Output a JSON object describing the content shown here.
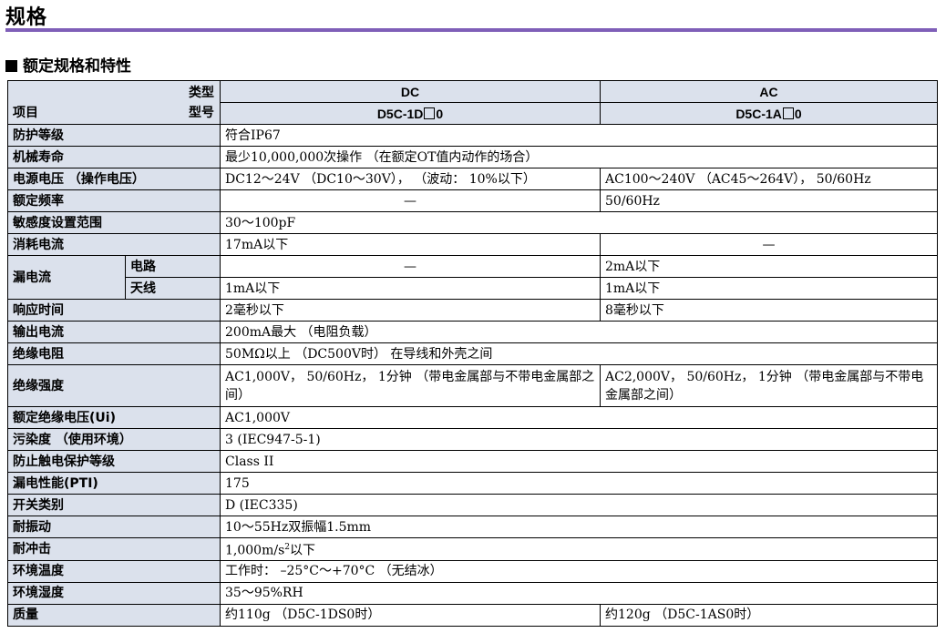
{
  "page_title": "规格",
  "section_heading": "额定规格和特性",
  "header": {
    "type_label": "类型",
    "item_label": "项目",
    "model_label": "型号",
    "dc": {
      "type": "DC",
      "model_prefix": "D5C-1D",
      "model_suffix": "0"
    },
    "ac": {
      "type": "AC",
      "model_prefix": "D5C-1A",
      "model_suffix": "0"
    }
  },
  "rows": {
    "protection": {
      "label": "防护等级",
      "value": "符合IP67"
    },
    "mech_life": {
      "label": "机械寿命",
      "value": "最少10,000,000次操作 （在额定OT值内动作的场合）"
    },
    "supply_voltage": {
      "label": "电源电压 （操作电压）",
      "dc": "DC12～24V （DC10～30V）， （波动： 10%以下）",
      "ac": "AC100～240V （AC45～264V）， 50/60Hz"
    },
    "rated_freq": {
      "label": "额定频率",
      "dc": "—",
      "ac": "50/60Hz"
    },
    "sensitivity": {
      "label": "敏感度设置范围",
      "value": "30～100pF"
    },
    "consumption": {
      "label": "消耗电流",
      "dc": "17mA以下",
      "ac": "—"
    },
    "leakage": {
      "label": "漏电流",
      "circuit": {
        "label": "电路",
        "dc": "—",
        "ac": "2mA以下"
      },
      "antenna": {
        "label": "天线",
        "dc": "1mA以下",
        "ac": "1mA以下"
      }
    },
    "response": {
      "label": "响应时间",
      "dc": "2毫秒以下",
      "ac": "8毫秒以下"
    },
    "output": {
      "label": "输出电流",
      "value": "200mA最大 （电阻负载）"
    },
    "insulation_res": {
      "label": "绝缘电阻",
      "value": "50MΩ以上 （DC500V时） 在导线和外壳之间"
    },
    "dielectric": {
      "label": "绝缘强度",
      "dc": "AC1,000V， 50/60Hz， 1分钟 （带电金属部与不带电金属部之间）",
      "ac": "AC2,000V， 50/60Hz， 1分钟 （带电金属部与不带电金属部之间）"
    },
    "rated_insulation_v": {
      "label": "额定绝缘电压(Ui)",
      "value": "AC1,000V"
    },
    "pollution": {
      "label": "污染度 （使用环境）",
      "value": "3 (IEC947-5-1)"
    },
    "shock_protection": {
      "label": "防止触电保护等级",
      "value": "Class II"
    },
    "pti": {
      "label": "漏电性能(PTI)",
      "value": "175"
    },
    "switch_class": {
      "label": "开关类别",
      "value": "D (IEC335)"
    },
    "vibration": {
      "label": "耐振动",
      "value": "10～55Hz双振幅1.5mm"
    },
    "shock": {
      "label": "耐冲击",
      "value_main": "1,000m/s",
      "value_sup": "2",
      "value_tail": "以下"
    },
    "ambient_temp": {
      "label": "环境温度",
      "value": "工作时： –25°C～+70°C （无结冰）"
    },
    "ambient_humidity": {
      "label": "环境湿度",
      "value": "35～95%RH"
    },
    "weight": {
      "label": "质量",
      "dc": "约110g （D5C-1DS0时）",
      "ac": "约120g （D5C-1AS0时）"
    }
  }
}
